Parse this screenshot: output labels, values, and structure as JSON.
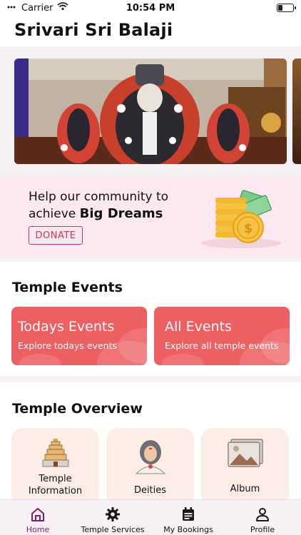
{
  "status": {
    "carrier": "Carrier",
    "time": "10:54 PM"
  },
  "header": {
    "title": "Srivari Sri Balaji"
  },
  "donate": {
    "line1": "Help our community to",
    "line2_prefix": "achieve",
    "line2_bold": "Big Dreams",
    "button": "DONATE"
  },
  "events": {
    "title": "Temple Events",
    "cards": [
      {
        "title": "Todays Events",
        "subtitle": "Explore todays events"
      },
      {
        "title": "All Events",
        "subtitle": "Explore all temple events"
      }
    ]
  },
  "overview": {
    "title": "Temple Overview",
    "cards": [
      {
        "line1": "Temple",
        "line2": "Information",
        "icon": "temple-icon"
      },
      {
        "label": "Deities",
        "icon": "deity-icon"
      },
      {
        "label": "Album",
        "icon": "album-icon"
      }
    ]
  },
  "tabs": [
    {
      "label": "Home",
      "icon": "home-icon",
      "active": true
    },
    {
      "label": "Temple Services",
      "icon": "gear-icon",
      "active": false
    },
    {
      "label": "My Bookings",
      "icon": "calendar-icon",
      "active": false
    },
    {
      "label": "Profile",
      "icon": "person-icon",
      "active": false
    }
  ],
  "colors": {
    "accent": "#7b1e6e",
    "event_card": "#ee5f61",
    "donate_bg": "#fbe9ef",
    "overview_card": "#fdeee5"
  }
}
